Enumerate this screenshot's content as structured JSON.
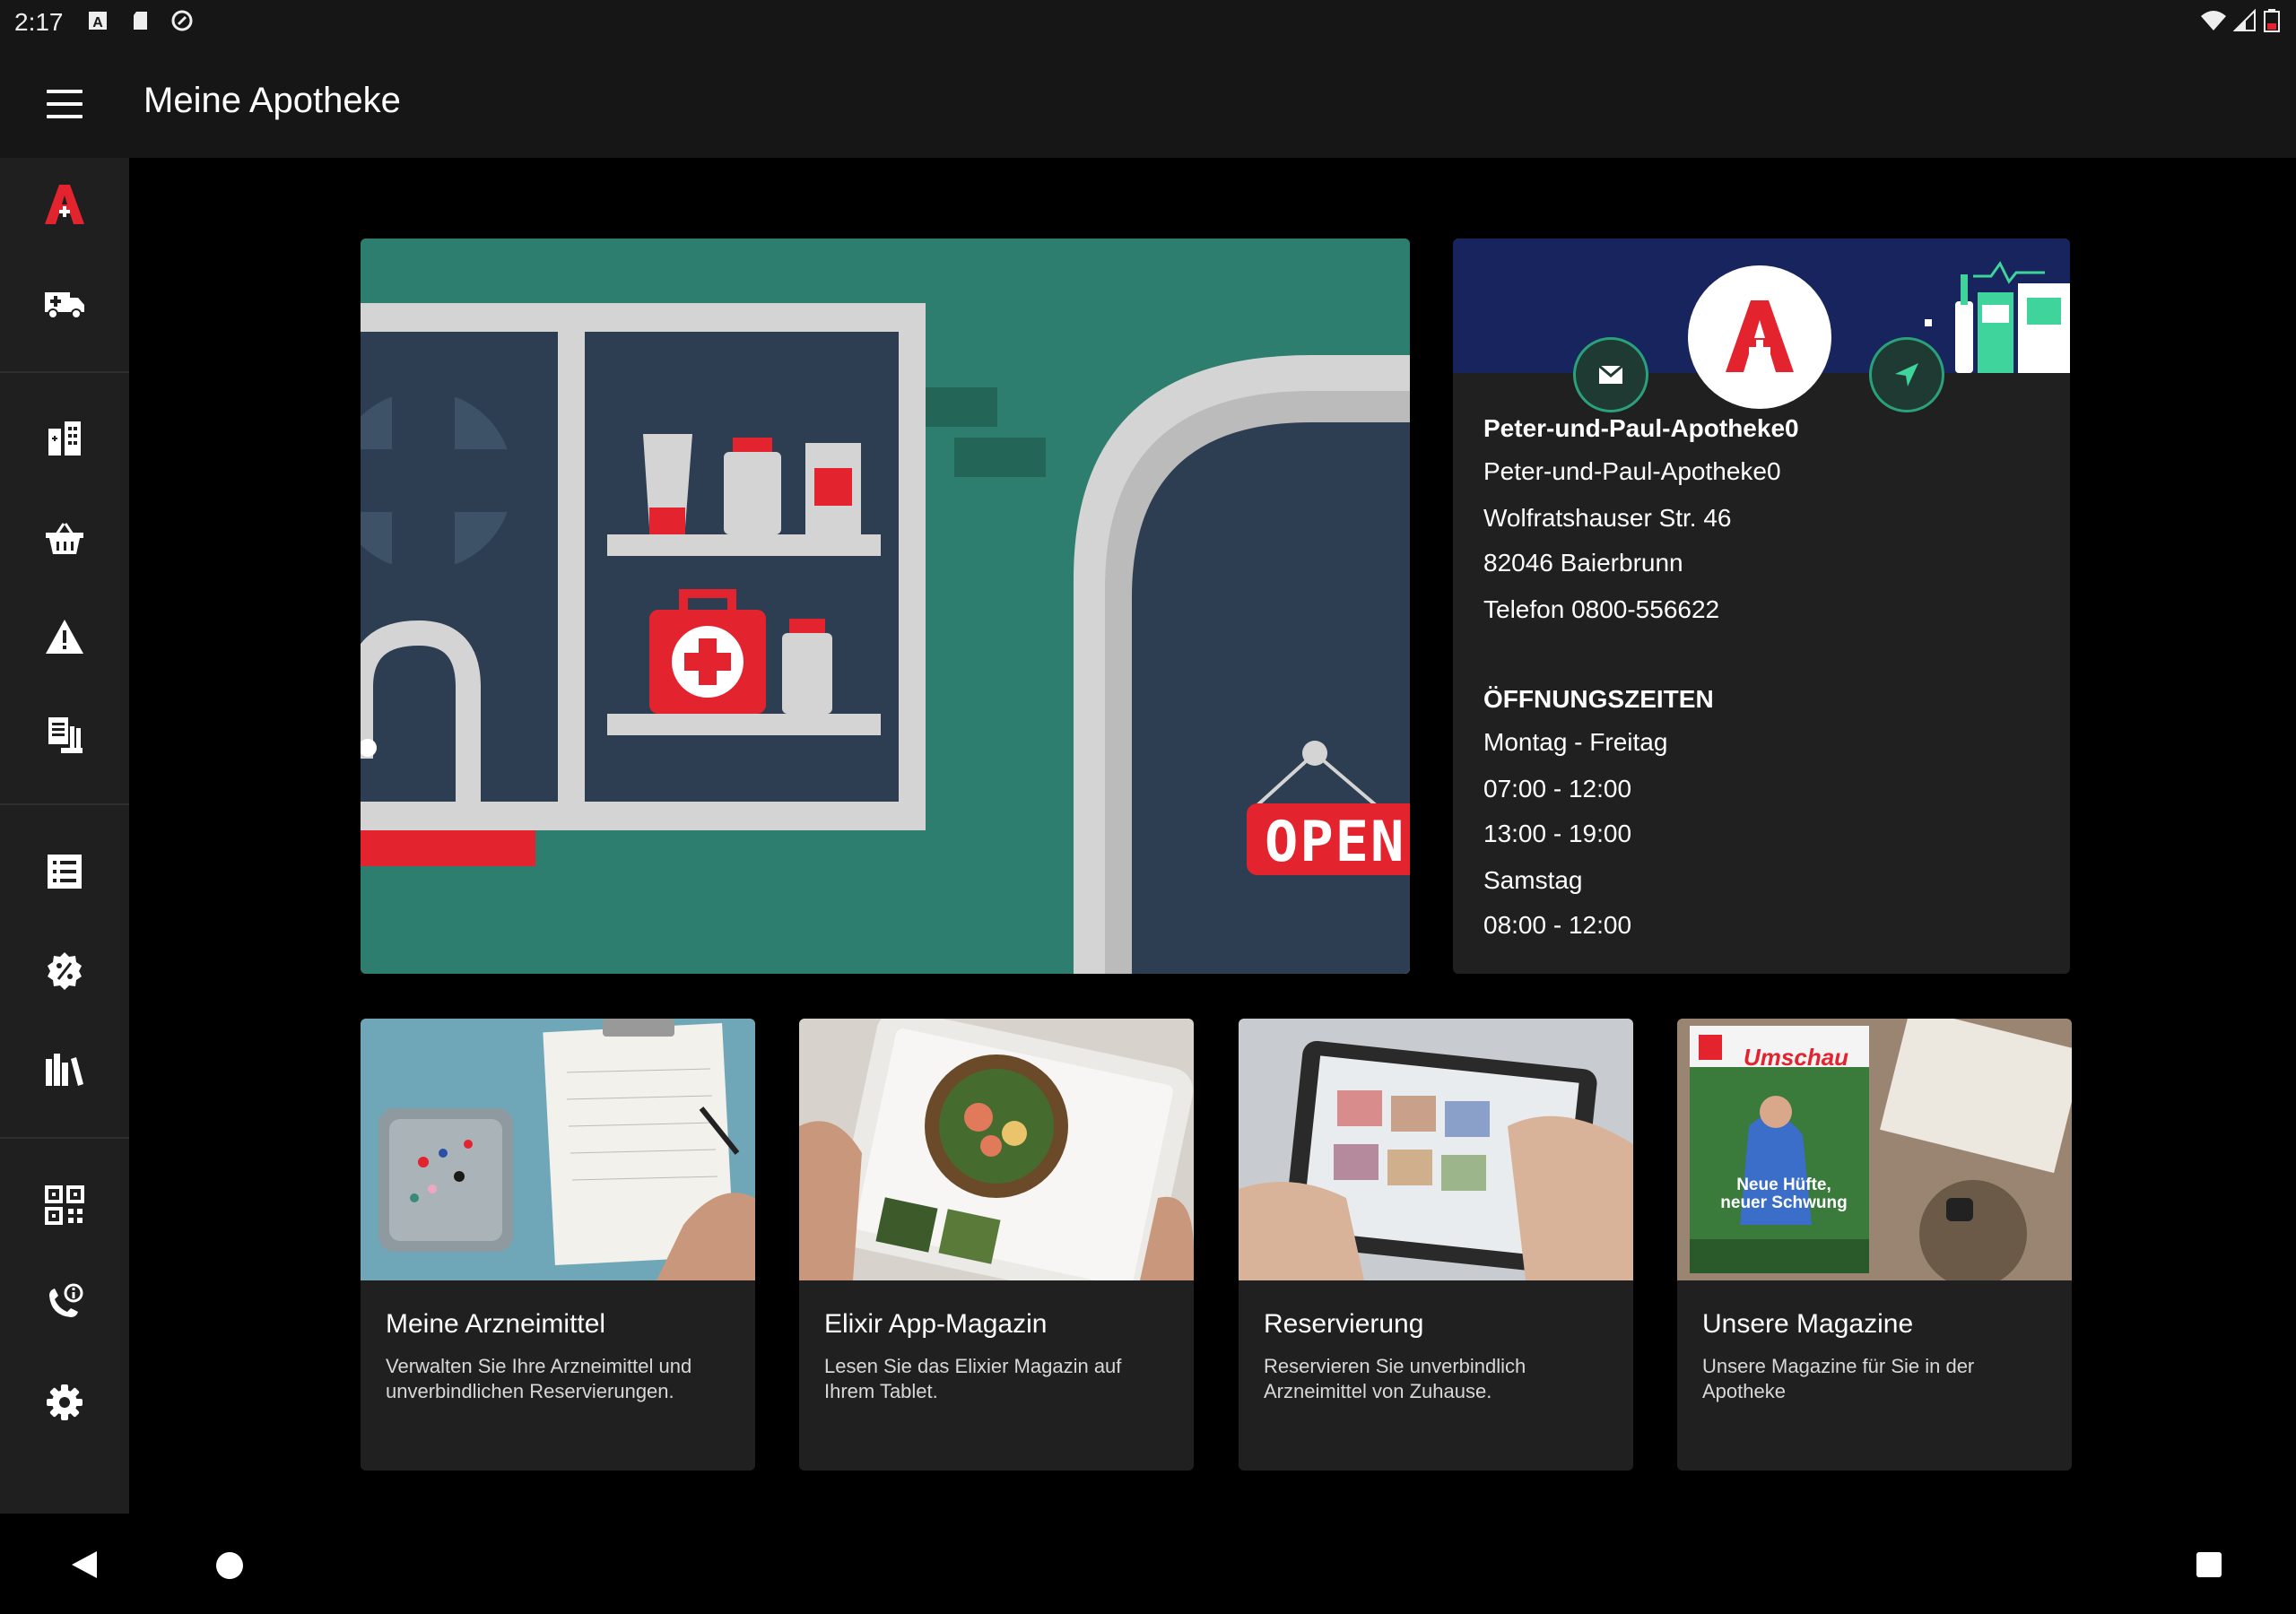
{
  "status_bar": {
    "time": "2:17",
    "icons": [
      "a-notification-icon",
      "sd-card-icon",
      "sync-icon",
      "wifi-icon",
      "signal-icon",
      "battery-low-icon"
    ]
  },
  "app_bar": {
    "title": "Meine Apotheke",
    "menu_icon": "hamburger-menu-icon"
  },
  "rail": {
    "items": [
      {
        "icon": "apotheke-logo-icon",
        "name": "rail-item-apotheke"
      },
      {
        "icon": "delivery-truck-icon",
        "name": "rail-item-delivery"
      },
      {
        "icon": "pharmacy-building-icon",
        "name": "rail-item-pharmacy"
      },
      {
        "icon": "basket-icon",
        "name": "rail-item-basket"
      },
      {
        "icon": "warning-icon",
        "name": "rail-item-warning"
      },
      {
        "icon": "documents-icon",
        "name": "rail-item-documents"
      },
      {
        "icon": "list-icon",
        "name": "rail-item-list"
      },
      {
        "icon": "discount-badge-icon",
        "name": "rail-item-offers"
      },
      {
        "icon": "library-icon",
        "name": "rail-item-library"
      },
      {
        "icon": "qr-code-icon",
        "name": "rail-item-qr"
      },
      {
        "icon": "phone-info-icon",
        "name": "rail-item-phone"
      },
      {
        "icon": "gear-icon",
        "name": "rail-item-settings"
      }
    ]
  },
  "hero": {
    "sign_text": "OPEN"
  },
  "pharmacy": {
    "name_bold": "Peter-und-Paul-Apotheke0",
    "name": "Peter-und-Paul-Apotheke0",
    "street": "Wolfratshauser Str. 46",
    "city": "82046 Baierbrunn",
    "phone": "Telefon 0800-556622",
    "hours_heading": "ÖFFNUNGSZEITEN",
    "hours": [
      {
        "text": "Montag - Freitag"
      },
      {
        "text": "07:00 - 12:00"
      },
      {
        "text": "13:00 - 19:00"
      },
      {
        "text": "Samstag"
      },
      {
        "text": "08:00 - 12:00"
      }
    ],
    "mail_icon": "mail-icon",
    "nav_icon": "navigation-arrow-icon"
  },
  "tiles": [
    {
      "title": "Meine Arzneimittel",
      "desc": "Verwalten Sie Ihre Arzneimittel und unverbindlichen Reservierungen."
    },
    {
      "title": "Elixir App-Magazin",
      "desc": "Lesen Sie das Elixier Magazin auf Ihrem Tablet."
    },
    {
      "title": "Reservierung",
      "desc": "Reservieren Sie unverbindlich Arzneimittel von Zuhause."
    },
    {
      "title": "Unsere Magazine",
      "desc": "Unsere Magazine für Sie in der Apotheke",
      "magazine_brand": "Umschau",
      "magazine_headline": "Neue Hüfte, neuer Schwung"
    }
  ],
  "colors": {
    "brand_red": "#e3232e",
    "hero_green": "#2d7e6e",
    "cabinet_navy": "#2d3e52",
    "banner_navy": "#17245e",
    "accent_green": "#2aa17a"
  }
}
